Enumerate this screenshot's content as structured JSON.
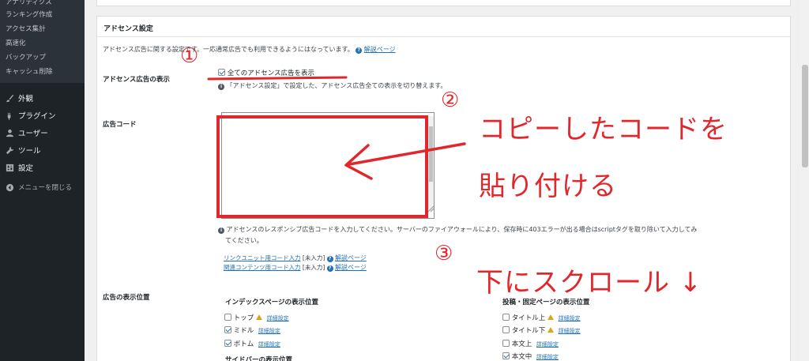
{
  "sidebar": {
    "submenu": [
      {
        "label": "アナリティクス"
      },
      {
        "label": "ランキング作成"
      },
      {
        "label": "アクセス集計"
      },
      {
        "label": "高速化"
      },
      {
        "label": "バックアップ"
      },
      {
        "label": "キャッシュ削除"
      }
    ],
    "menu": [
      {
        "label": "外観",
        "icon": "paintbrush-icon"
      },
      {
        "label": "プラグイン",
        "icon": "plugin-icon"
      },
      {
        "label": "ユーザー",
        "icon": "user-icon"
      },
      {
        "label": "ツール",
        "icon": "wrench-icon"
      },
      {
        "label": "設定",
        "icon": "settings-icon"
      }
    ],
    "collapse_label": "メニューを閉じる"
  },
  "panel": {
    "title": "アドセンス設定",
    "description": "アドセンス広告に関する設定です。一応通常広告でも利用できるようにはなっています。",
    "help_link": "解説ページ",
    "display_all": {
      "label": "アドセンス広告の表示",
      "checkbox_label": "全てのアドセンス広告を表示",
      "checked": true,
      "note": "「アドセンス設定」で設定した、アドセンス広告全ての表示を切り替えます。"
    },
    "ad_code": {
      "label": "広告コード",
      "value": "",
      "note_line1": "アドセンスのレスポンシブ広告コードを入力してください。サーバーのファイアウォールにより、保存時に403エラーが出る場合はscriptタグを取り除いて入力してみ",
      "note_line2": "てください。",
      "link_unit": {
        "text": "リンクユニット用コード入力",
        "status": "[未入力]",
        "help": "解説ページ"
      },
      "related": {
        "text": "関連コンテンツ用コード入力",
        "status": "[未入力]",
        "help": "解説ページ"
      }
    },
    "positions": {
      "label": "広告の表示位置",
      "index_heading": "インデックスページの表示位置",
      "index_items": [
        {
          "label": "トップ",
          "checked": false,
          "warn": true,
          "detail": "詳細設定"
        },
        {
          "label": "ミドル",
          "checked": true,
          "warn": false,
          "detail": "詳細設定"
        },
        {
          "label": "ボトム",
          "checked": true,
          "warn": false,
          "detail": "詳細設定"
        }
      ],
      "sidebar_heading": "サイドバーの表示位置",
      "post_heading": "投稿・固定ページの表示位置",
      "post_items": [
        {
          "label": "タイトル上",
          "checked": false,
          "warn": true,
          "detail": "詳細設定"
        },
        {
          "label": "タイトル下",
          "checked": false,
          "warn": true,
          "detail": "詳細設定"
        },
        {
          "label": "本文上",
          "checked": false,
          "warn": false,
          "detail": "詳細設定"
        },
        {
          "label": "本文中",
          "checked": true,
          "warn": false,
          "detail": "詳細設定"
        }
      ]
    }
  },
  "annotations": {
    "step1": "①",
    "step2": "②",
    "step3": "③",
    "copy_text": "コピーしたコードを",
    "paste_text": "貼り付ける",
    "scroll_text": "下にスクロール ↓",
    "color": "#e0272c"
  }
}
